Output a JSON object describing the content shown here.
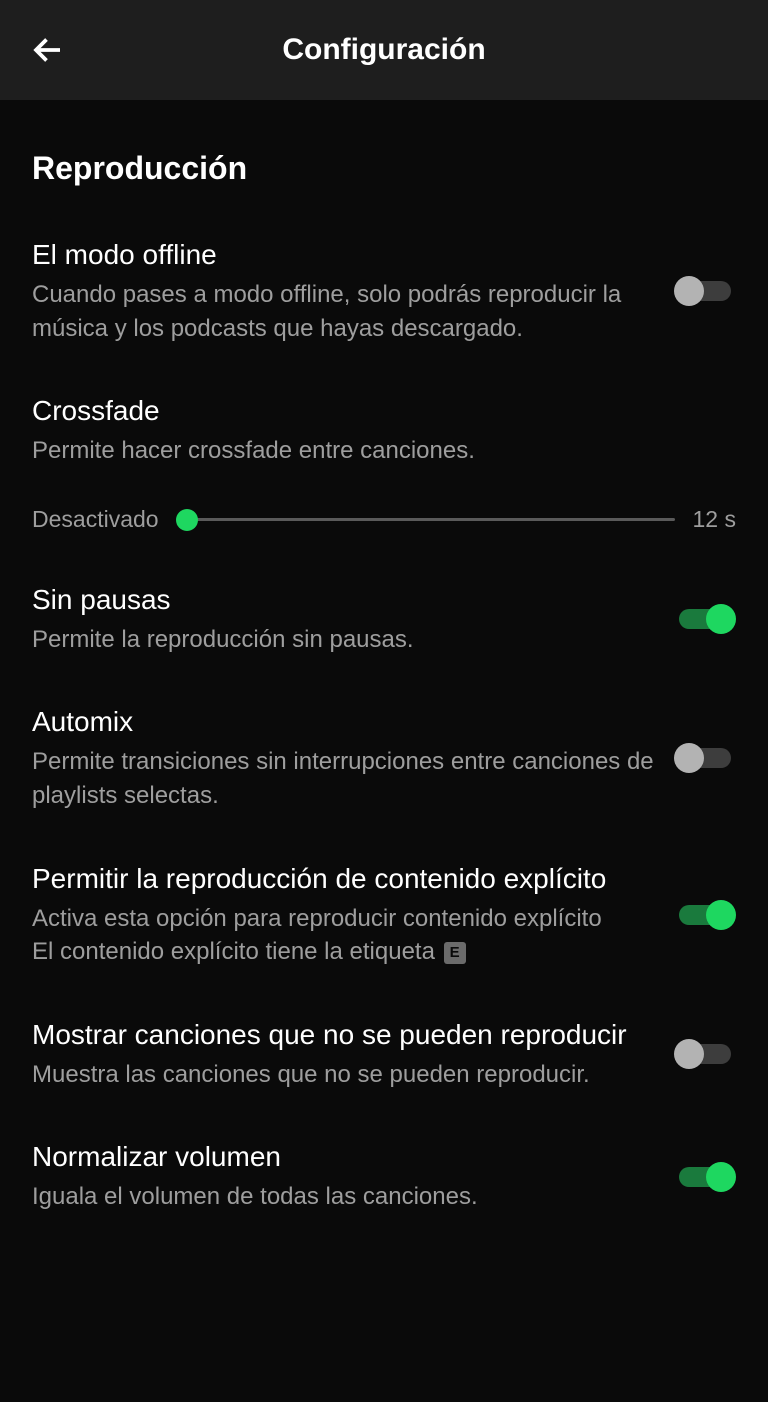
{
  "header": {
    "title": "Configuración"
  },
  "section": {
    "title": "Reproducción"
  },
  "settings": {
    "offline": {
      "title": "El modo offline",
      "desc": "Cuando pases a modo offline, solo podrás reproducir la música y los podcasts que hayas descargado.",
      "enabled": false
    },
    "crossfade": {
      "title": "Crossfade",
      "desc": "Permite hacer crossfade entre canciones.",
      "min_label": "Desactivado",
      "max_label": "12 s",
      "value_percent": 2
    },
    "gapless": {
      "title": "Sin pausas",
      "desc": "Permite la reproducción sin pausas.",
      "enabled": true
    },
    "automix": {
      "title": "Automix",
      "desc": "Permite transiciones sin interrupciones entre canciones de playlists selectas.",
      "enabled": false
    },
    "explicit": {
      "title": "Permitir la reproducción de contenido explícito",
      "desc_line1": "Activa esta opción para reproducir contenido explícito",
      "desc_line2_prefix": "El contenido explícito tiene la etiqueta ",
      "badge": "E",
      "enabled": true
    },
    "unavailable": {
      "title": "Mostrar canciones que no se pueden reproducir",
      "desc": "Muestra las canciones que no se pueden reproducir.",
      "enabled": false
    },
    "normalize": {
      "title": "Normalizar volumen",
      "desc": "Iguala el volumen de todas las canciones.",
      "enabled": true
    }
  },
  "colors": {
    "accent": "#1ed760"
  }
}
